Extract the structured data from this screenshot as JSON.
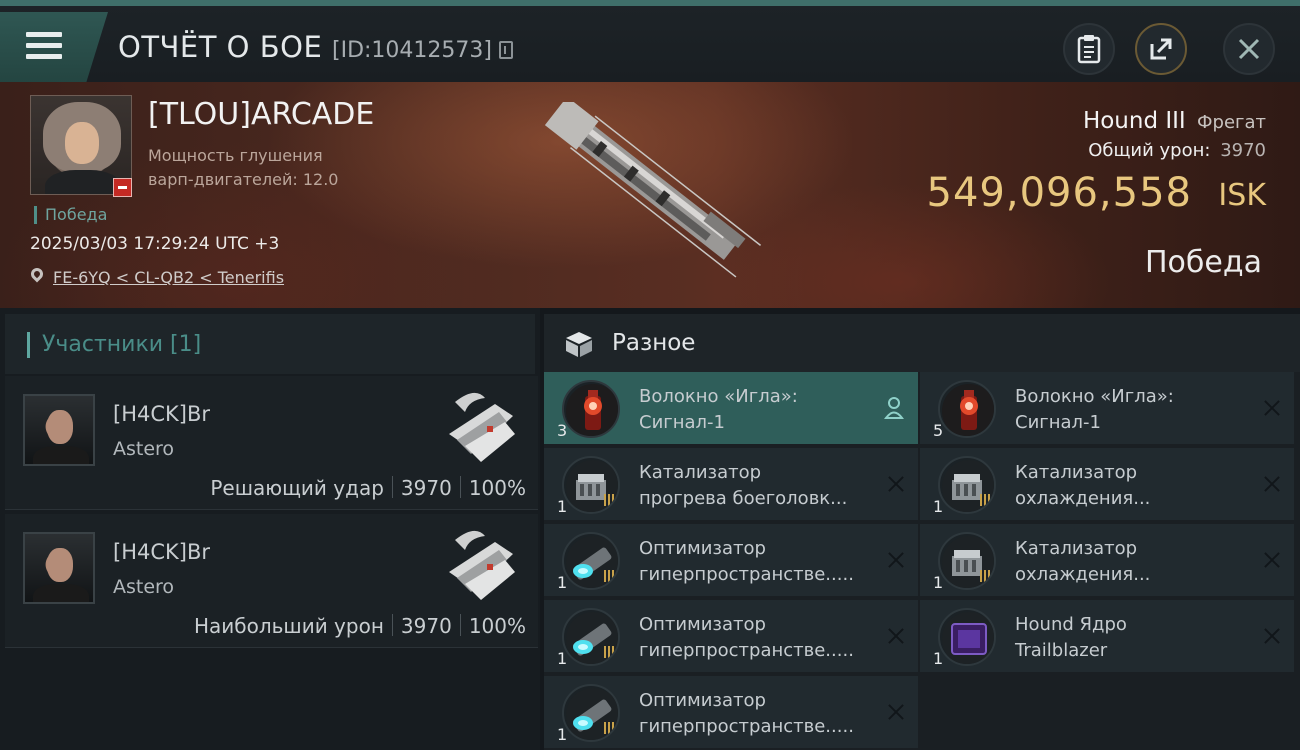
{
  "header": {
    "title": "ОТЧЁТ О БОЕ",
    "id_text": "[ID:10412573]",
    "icons": [
      "menu-icon",
      "copy-icon",
      "clipboard-icon",
      "share-icon",
      "close-icon"
    ]
  },
  "victim": {
    "name": "[TLOU]ARCADE",
    "stat_line1": "Мощность глушения",
    "stat_line2": "варп-двигателей: 12.0",
    "result_tag": "Победа",
    "datetime": "2025/03/03 17:29:24 UTC +3",
    "location": "FE-6YQ < CL-QB2 < Tenerifis",
    "ship_name": "Hound III",
    "ship_class": "Фрегат",
    "total_damage_label": "Общий урон:",
    "total_damage_value": "3970",
    "isk_value": "549,096,558",
    "isk_unit": "ISK",
    "result_big": "Победа"
  },
  "participants": {
    "title": "Участники [1]",
    "rows": [
      {
        "name": "[H4CK]Br",
        "ship": "Astero",
        "role": "Решающий удар",
        "damage": "3970",
        "percent": "100%"
      },
      {
        "name": "[H4CK]Br",
        "ship": "Astero",
        "role": "Наибольший урон",
        "damage": "3970",
        "percent": "100%"
      }
    ]
  },
  "items": {
    "title": "Разное",
    "left": [
      {
        "qty": "3",
        "line1": "Волокно «Игла»:",
        "line2": "Сигнал-1",
        "icon": "red-booster-icon",
        "status": "person"
      },
      {
        "qty": "1",
        "line1": "Катализатор",
        "line2": "прогрева боеголовк...",
        "icon": "catalyst-icon",
        "status": "destroyed"
      },
      {
        "qty": "1",
        "line1": "Оптимизатор",
        "line2": "гиперпространстве.....",
        "icon": "optimizer-icon",
        "status": "destroyed"
      },
      {
        "qty": "1",
        "line1": "Оптимизатор",
        "line2": "гиперпространстве.....",
        "icon": "optimizer-icon",
        "status": "destroyed"
      },
      {
        "qty": "1",
        "line1": "Оптимизатор",
        "line2": "гиперпространстве.....",
        "icon": "optimizer-icon",
        "status": "destroyed"
      }
    ],
    "right": [
      {
        "qty": "5",
        "line1": "Волокно «Игла»:",
        "line2": "Сигнал-1",
        "icon": "red-booster-icon",
        "status": "destroyed"
      },
      {
        "qty": "1",
        "line1": "Катализатор",
        "line2": "охлаждения...",
        "icon": "catalyst-icon",
        "status": "destroyed"
      },
      {
        "qty": "1",
        "line1": "Катализатор",
        "line2": "охлаждения...",
        "icon": "catalyst-icon",
        "status": "destroyed"
      },
      {
        "qty": "1",
        "line1": "Hound Ядро",
        "line2": "Trailblazer",
        "icon": "core-chip-icon",
        "status": "destroyed"
      }
    ]
  },
  "colors": {
    "accent": "#4a8d88",
    "isk": "#e8c77f",
    "selected_row": "#2f5e5a",
    "loss_badge": "#c42a24"
  }
}
